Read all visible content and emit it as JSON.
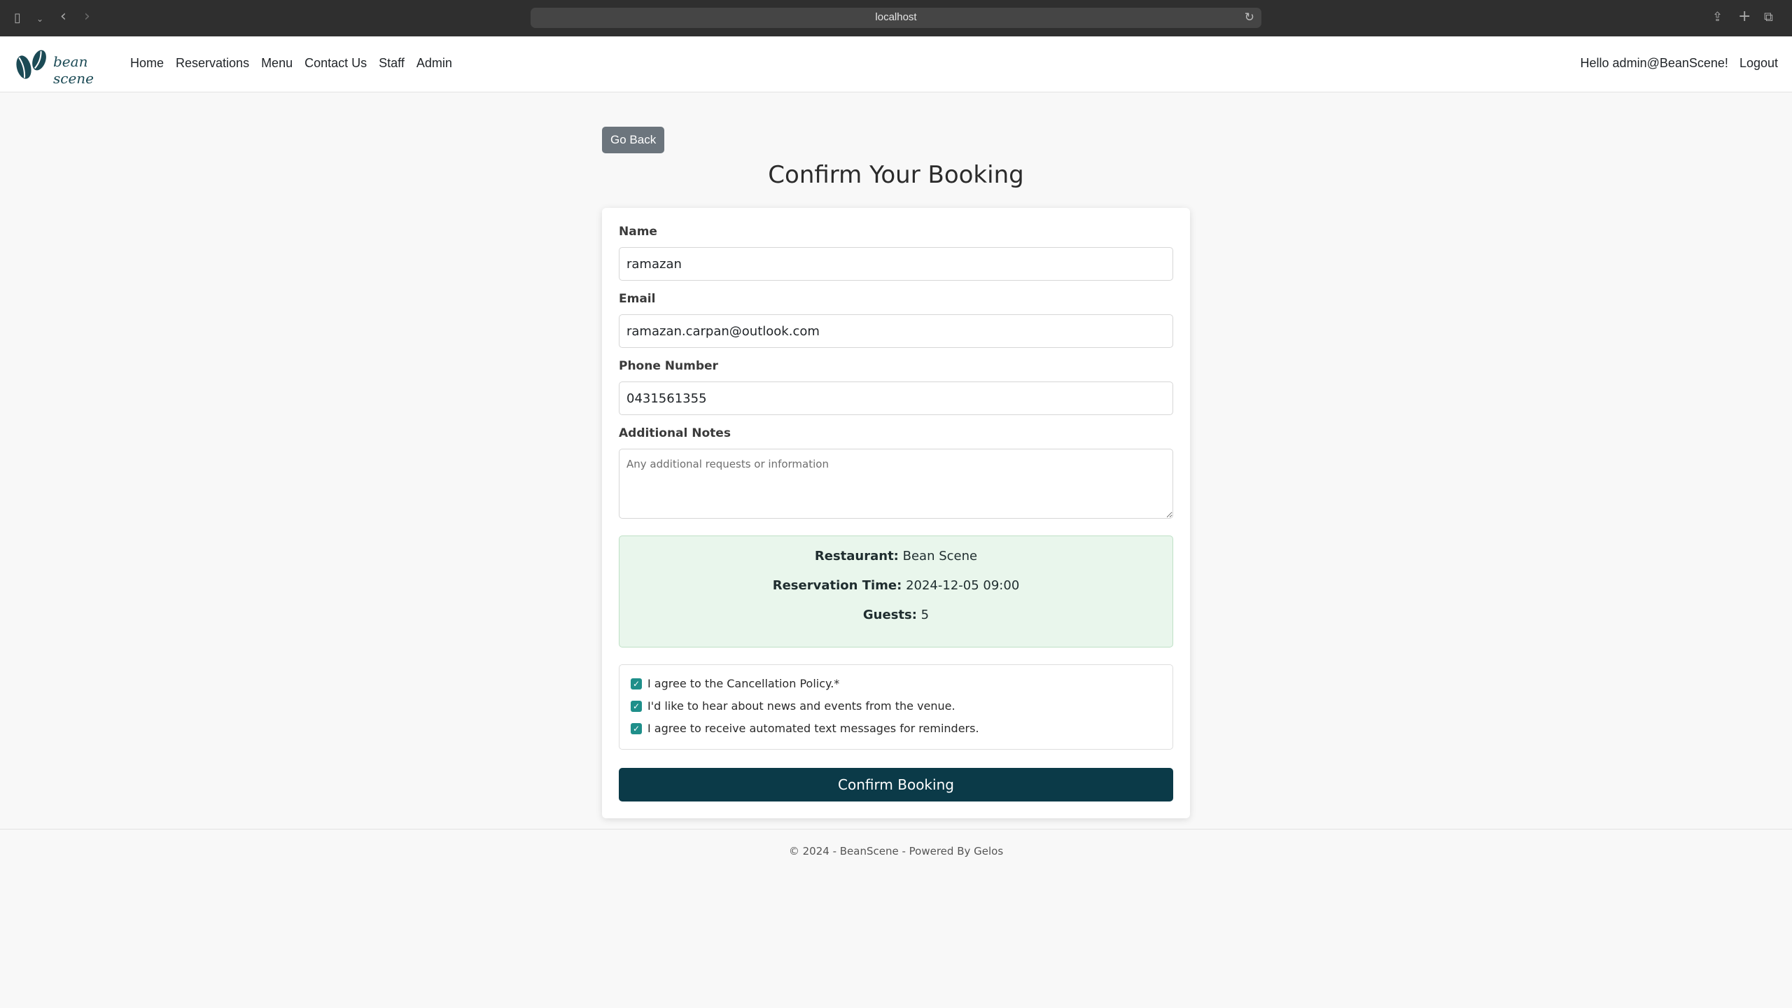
{
  "browser": {
    "url": "localhost",
    "icons": {
      "sidebar": "sidebar-icon",
      "back": "back-arrow-icon",
      "forward": "forward-arrow-icon",
      "reload": "reload-icon",
      "share": "share-icon",
      "new_tab": "plus-icon",
      "tabs": "tabs-overview-icon"
    }
  },
  "header": {
    "logo_text": "bean scene",
    "nav": [
      "Home",
      "Reservations",
      "Menu",
      "Contact Us",
      "Staff",
      "Admin"
    ],
    "greeting": "Hello admin@BeanScene!",
    "logout": "Logout"
  },
  "page": {
    "back_label": "Go Back",
    "title": "Confirm Your Booking"
  },
  "form": {
    "name_label": "Name",
    "name_value": "ramazan",
    "email_label": "Email",
    "email_value": "ramazan.carpan@outlook.com",
    "phone_label": "Phone Number",
    "phone_value": "0431561355",
    "notes_label": "Additional Notes",
    "notes_placeholder": "Any additional requests or information"
  },
  "summary": {
    "restaurant_label": "Restaurant:",
    "restaurant_value": "Bean Scene",
    "time_label": "Reservation Time:",
    "time_value": "2024-12-05 09:00",
    "guests_label": "Guests:",
    "guests_value": "5"
  },
  "checkboxes": [
    {
      "label": "I agree to the Cancellation Policy.*",
      "checked": true
    },
    {
      "label": "I'd like to hear about news and events from the venue.",
      "checked": true
    },
    {
      "label": "I agree to receive automated text messages for reminders.",
      "checked": true
    }
  ],
  "confirm_label": "Confirm Booking",
  "footer": "© 2024 - BeanScene - Powered By Gelos",
  "colors": {
    "primary": "#0b3a48",
    "summary_bg": "#e9f6ec",
    "checkbox": "#1f8f8a",
    "secondary_button": "#6c757d"
  }
}
